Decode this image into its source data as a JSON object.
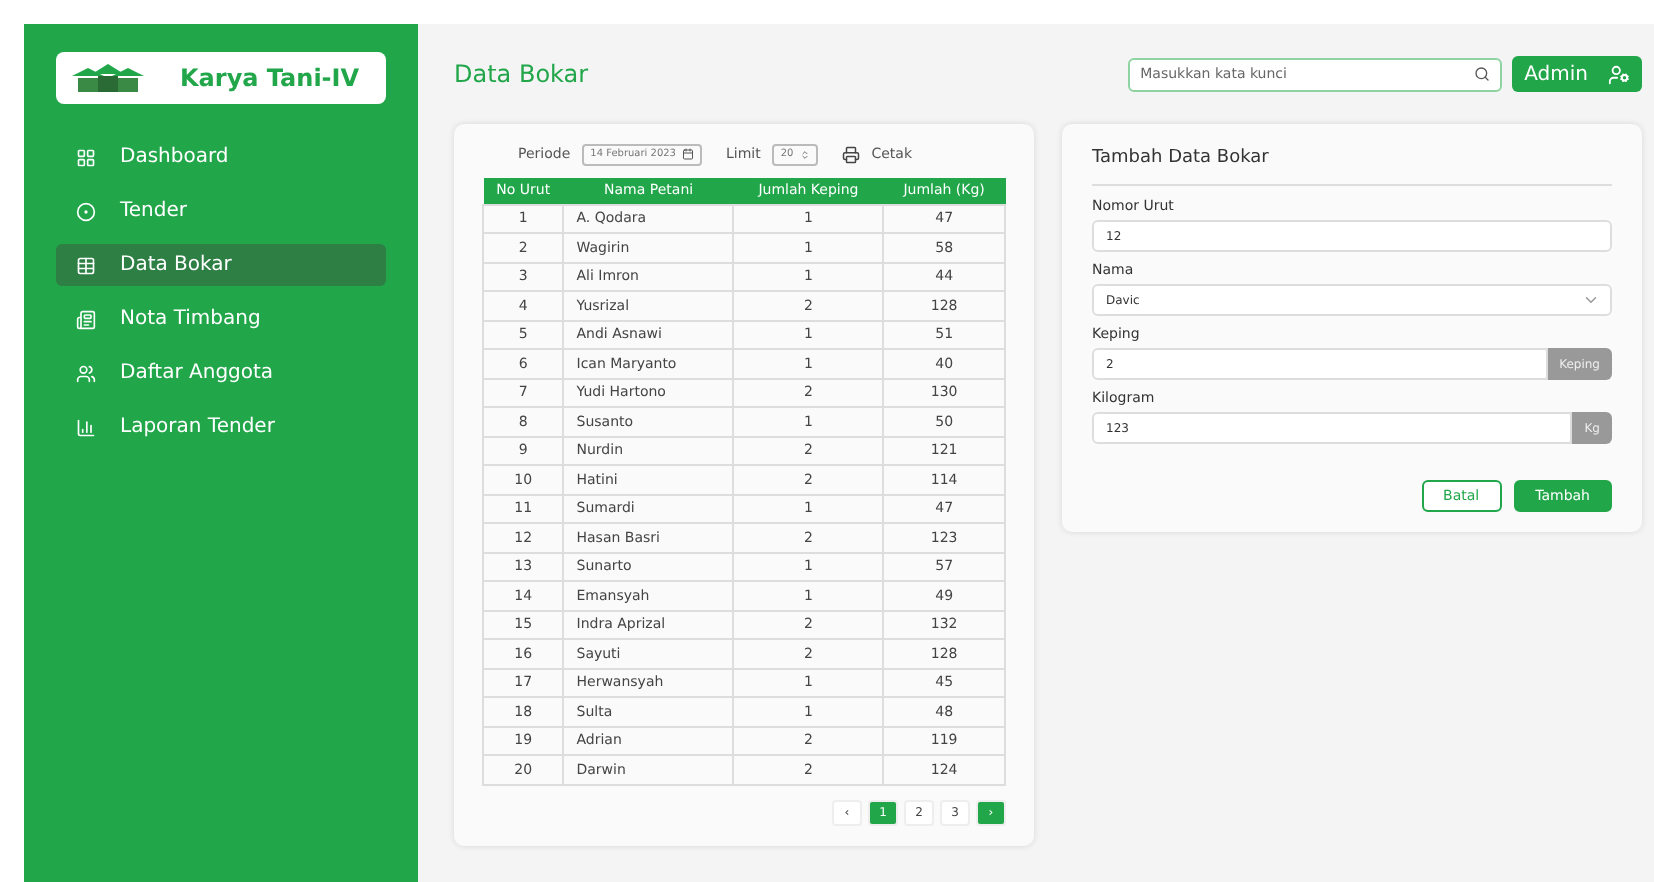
{
  "sidebar": {
    "brand": "Karya Tani-IV",
    "items": [
      {
        "label": "Dashboard",
        "selected": false
      },
      {
        "label": "Tender",
        "selected": false
      },
      {
        "label": "Data Bokar",
        "selected": true
      },
      {
        "label": "Nota Timbang",
        "selected": false
      },
      {
        "label": "Daftar Anggota",
        "selected": false
      },
      {
        "label": "Laporan Tender",
        "selected": false
      }
    ]
  },
  "header": {
    "title": "Data Bokar",
    "search": {
      "placeholder": "Masukkan kata kunci"
    },
    "user": "Admin"
  },
  "filters": {
    "period_label": "Periode",
    "period": "14 Februari 2023",
    "limit_label": "Limit",
    "limit": "20",
    "print": "Cetak"
  },
  "table": {
    "columns": [
      "No Urut",
      "Nama Petani",
      "Jumlah Keping",
      "Jumlah (Kg)"
    ],
    "rows": [
      [
        "1",
        "A. Qodara",
        "1",
        "47"
      ],
      [
        "2",
        "Wagirin",
        "1",
        "58"
      ],
      [
        "3",
        "Ali Imron",
        "1",
        "44"
      ],
      [
        "4",
        "Yusrizal",
        "2",
        "128"
      ],
      [
        "5",
        "Andi Asnawi",
        "1",
        "51"
      ],
      [
        "6",
        "Ican Maryanto",
        "1",
        "40"
      ],
      [
        "7",
        "Yudi Hartono",
        "2",
        "130"
      ],
      [
        "8",
        "Susanto",
        "1",
        "50"
      ],
      [
        "9",
        "Nurdin",
        "2",
        "121"
      ],
      [
        "10",
        "Hatini",
        "2",
        "114"
      ],
      [
        "11",
        "Sumardi",
        "1",
        "47"
      ],
      [
        "12",
        "Hasan Basri",
        "2",
        "123"
      ],
      [
        "13",
        "Sunarto",
        "1",
        "57"
      ],
      [
        "14",
        "Emansyah",
        "1",
        "49"
      ],
      [
        "15",
        "Indra Aprizal",
        "2",
        "132"
      ],
      [
        "16",
        "Sayuti",
        "2",
        "128"
      ],
      [
        "17",
        "Herwansyah",
        "1",
        "45"
      ],
      [
        "18",
        "Sulta",
        "1",
        "48"
      ],
      [
        "19",
        "Adrian",
        "2",
        "119"
      ],
      [
        "20",
        "Darwin",
        "2",
        "124"
      ]
    ]
  },
  "pagination": {
    "prev": "‹",
    "pages": [
      {
        "label": "1",
        "selected": true
      },
      {
        "label": "2",
        "selected": false
      },
      {
        "label": "3",
        "selected": false
      }
    ],
    "next": "›"
  },
  "form": {
    "title": "Tambah Data Bokar",
    "fields": [
      {
        "kind": "text",
        "label": "Nomor Urut",
        "value": "12"
      },
      {
        "kind": "select",
        "label": "Nama",
        "value": "Davic"
      },
      {
        "kind": "addon",
        "label": "Keping",
        "value": "2",
        "addon": "Keping"
      },
      {
        "kind": "addon",
        "label": "Kilogram",
        "value": "123",
        "addon": "Kg"
      }
    ],
    "cancel": "Batal",
    "submit": "Tambah"
  }
}
